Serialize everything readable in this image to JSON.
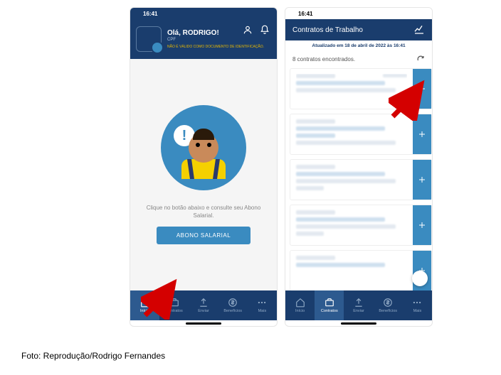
{
  "statusbar": {
    "time": "16:41",
    "signal": "􀙇",
    "wifi": "􀙈",
    "battery": "􀛨"
  },
  "phone1": {
    "header": {
      "greeting": "Olá, RODRIGO!",
      "sub1": "CPF",
      "sub2": "NÃO É VÁLIDO COMO DOCUMENTO DE IDENTIFICAÇÃO."
    },
    "speech": "!",
    "prompt": "Clique no botão abaixo e consulte seu Abono Salarial.",
    "button": "ABONO SALARIAL"
  },
  "phone2": {
    "title": "Contratos de Trabalho",
    "updated": "Atualizado em 18 de abril de 2022 às 16:41",
    "found": "8 contratos encontrados."
  },
  "nav": {
    "inicio": "Início",
    "contratos": "Contratos",
    "enviar": "Enviar",
    "beneficios": "Benefícios",
    "mais": "Mais"
  },
  "caption": "Foto: Reprodução/Rodrigo Fernandes"
}
